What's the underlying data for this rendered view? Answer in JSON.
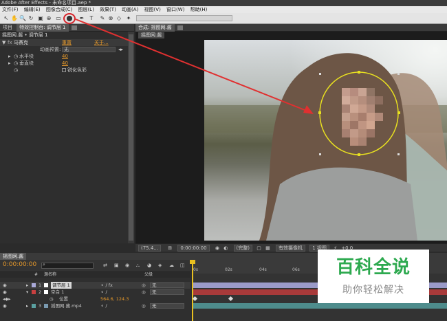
{
  "title_bar": {
    "title": "Adobe After Effects - 未命名项目.aep *"
  },
  "menu": [
    "文件(F)",
    "编辑(E)",
    "图像合成(C)",
    "图层(L)",
    "效果(T)",
    "动画(A)",
    "视图(V)",
    "窗口(W)",
    "帮助(H)"
  ],
  "toolbar": {
    "tools": [
      "selection-tool",
      "hand-tool",
      "zoom-tool",
      "rotate-tool",
      "camera-tool",
      "pan-behind-tool",
      "mask-tool",
      "ellipse-mask-tool",
      "pen-tool",
      "text-tool",
      "brush-tool",
      "clone-tool",
      "eraser-tool",
      "puppet-tool"
    ],
    "highlighted_tool": "ellipse-mask-tool",
    "highlight_color": "#d8232a"
  },
  "left_panel": {
    "tabs": [
      {
        "label": "项目"
      },
      {
        "label": "特效控制台: 调节层 1"
      }
    ],
    "breadcrumb": "摇图网.酱 • 调节层 1",
    "effect": {
      "name": "马赛克",
      "reset": "重置",
      "about": "关于...",
      "animation_preset_label": "动画预置:",
      "animation_preset_value": "无",
      "params": [
        {
          "label": "水平块",
          "value": "40"
        },
        {
          "label": "垂直块",
          "value": "40"
        }
      ],
      "checkbox_label": "锐化色彩"
    }
  },
  "comp_panel": {
    "tab_label": "合成: 摇图网.酱",
    "comp_tab": "摇图网.酱",
    "viewer_bar": {
      "zoom": "(75.4...",
      "timecode": "0:00:00:00",
      "resolution": "(完整)",
      "camera": "有效摄像机",
      "views": "1 视图",
      "exposure": "+0.0"
    }
  },
  "timeline": {
    "tab_label": "摇图网.酱",
    "timecode": "0:00:00:00",
    "search_placeholder": "",
    "column_headers": [
      "#",
      "源名称",
      "父级"
    ],
    "ruler": [
      "0s",
      "02s",
      "04s",
      "06s"
    ],
    "layers": [
      {
        "num": "1",
        "name": "调节层 1",
        "parent": "无",
        "color": "#a9a9d8"
      },
      {
        "num": "2",
        "name": "空白 1",
        "parent": "无",
        "color": "#c84040"
      },
      {
        "num": "",
        "name": "位置",
        "parent": "564.6, 124.3",
        "color": ""
      },
      {
        "num": "3",
        "name": "摇图网.酱.mp4",
        "parent": "无",
        "color": "#5aa0a0"
      }
    ]
  },
  "watermark": {
    "title": "百科全说",
    "subtitle": "助你轻松解决"
  },
  "annotation": {
    "color": "#e03030"
  }
}
